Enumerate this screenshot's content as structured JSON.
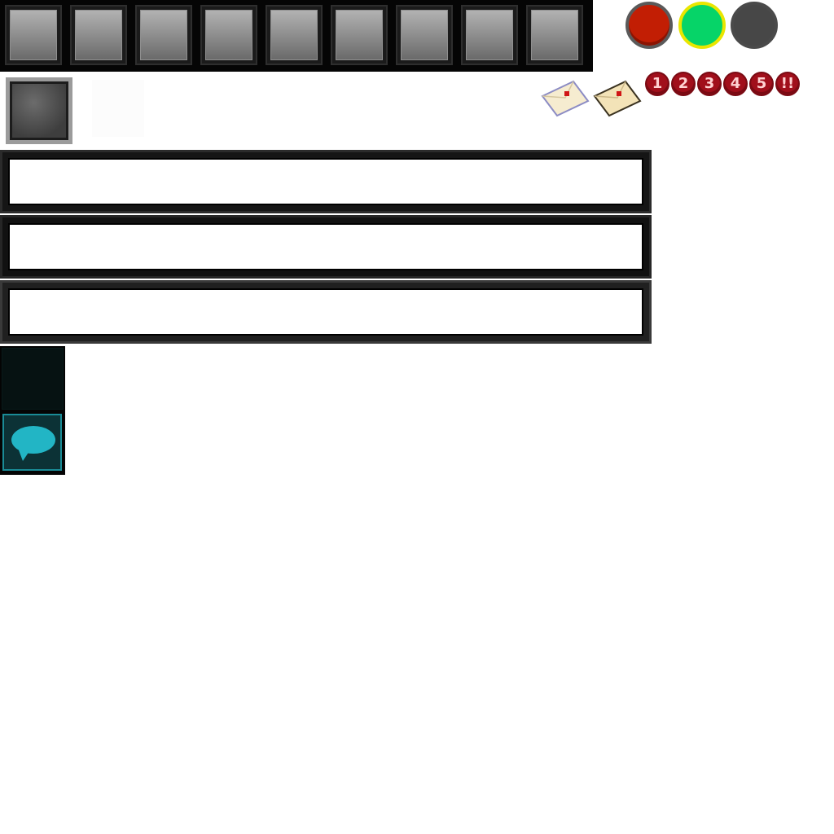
{
  "hotbar": {
    "slots": [
      "",
      "",
      "",
      "",
      "",
      "",
      "",
      "",
      ""
    ]
  },
  "status": {
    "dots": [
      {
        "name": "red",
        "color": "#c21e04"
      },
      {
        "name": "green",
        "color": "#06d468"
      },
      {
        "name": "grey",
        "color": "#474747"
      }
    ]
  },
  "inventory": {
    "selected_slot_icon": "blank-item-icon"
  },
  "mail": {
    "icons": [
      "letter-icon",
      "letter-icon"
    ]
  },
  "badges": [
    "1",
    "2",
    "3",
    "4",
    "5",
    "!!"
  ],
  "text_bars": [
    {
      "value": ""
    },
    {
      "value": ""
    },
    {
      "value": ""
    }
  ],
  "side_buttons": {
    "top_icon": "dark-button",
    "chat_icon": "speech-bubble-icon",
    "chat_color": "#22b5c5"
  }
}
